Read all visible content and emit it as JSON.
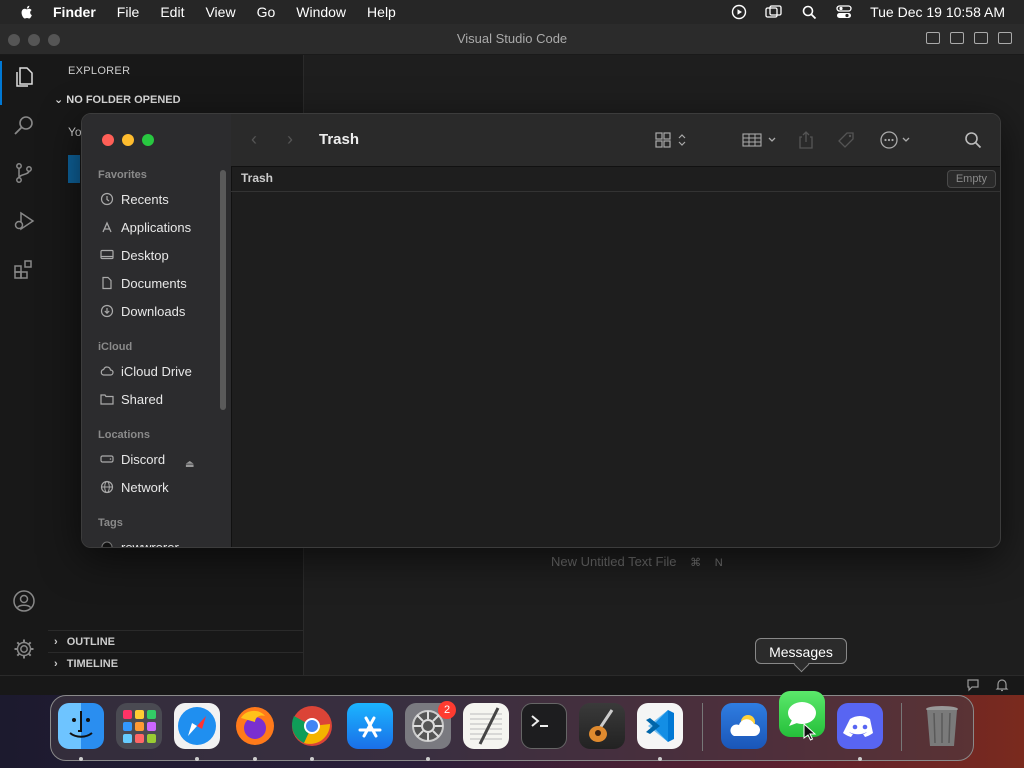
{
  "menubar": {
    "app_name": "Finder",
    "items": [
      "File",
      "Edit",
      "View",
      "Go",
      "Window",
      "Help"
    ],
    "clock": "Tue Dec 19  10:58 AM"
  },
  "vscode": {
    "window_title": "Visual Studio Code",
    "explorer_title": "EXPLORER",
    "no_folder": "NO FOLDER OPENED",
    "partial_text": "Yo",
    "outline": "OUTLINE",
    "timeline": "TIMELINE",
    "editor_hint": "New Untitled Text File",
    "editor_hint_keys": [
      "⌘",
      "N"
    ]
  },
  "finder": {
    "title": "Trash",
    "path_label": "Trash",
    "empty_button": "Empty",
    "sections": {
      "favorites": "Favorites",
      "icloud": "iCloud",
      "locations": "Locations",
      "tags": "Tags"
    },
    "favorites": [
      {
        "label": "Recents",
        "icon": "clock-icon"
      },
      {
        "label": "Applications",
        "icon": "applications-icon"
      },
      {
        "label": "Desktop",
        "icon": "desktop-icon"
      },
      {
        "label": "Documents",
        "icon": "document-icon"
      },
      {
        "label": "Downloads",
        "icon": "download-icon"
      }
    ],
    "icloud": [
      {
        "label": "iCloud Drive",
        "icon": "cloud-icon"
      },
      {
        "label": "Shared",
        "icon": "shared-folder-icon"
      }
    ],
    "locations": [
      {
        "label": "Discord",
        "icon": "drive-icon"
      },
      {
        "label": "Network",
        "icon": "globe-icon"
      }
    ],
    "tags": [
      {
        "label": "rewwrerer",
        "icon": "tag-dot-icon"
      }
    ]
  },
  "dock": {
    "tooltip": "Messages",
    "settings_badge": "2",
    "apps": [
      "Finder",
      "Launchpad",
      "Safari",
      "Firefox",
      "Chrome",
      "App Store",
      "System Settings",
      "TextEdit",
      "Terminal",
      "GarageBand",
      "Visual Studio Code",
      "Weather",
      "Messages",
      "Discord",
      "Trash"
    ]
  }
}
